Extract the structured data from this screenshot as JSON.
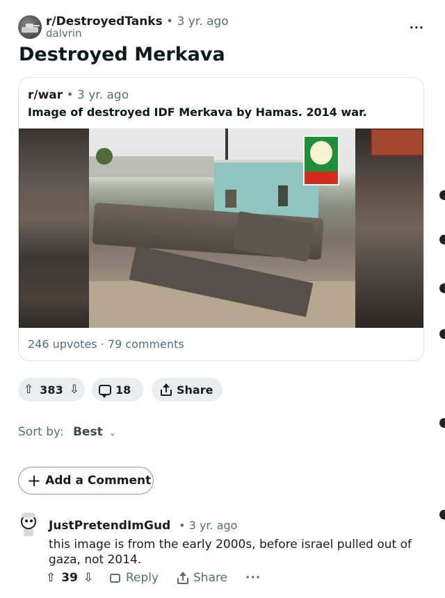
{
  "post": {
    "subreddit": "r/DestroyedTanks",
    "separator": "•",
    "time": "3 yr. ago",
    "author": "dalvrin",
    "overflow": "···",
    "title": "Destroyed Merkava"
  },
  "crosspost": {
    "subreddit": "r/war",
    "separator": "•",
    "time": "3 yr. ago",
    "title": "Image of destroyed IDF Merkava by Hamas. 2014 war.",
    "stats": "246 upvotes · 79 comments",
    "image_icon": "destroyed-tank-photo"
  },
  "actions": {
    "score": "383",
    "comments": "18",
    "share": "Share"
  },
  "sort": {
    "label": "Sort by:",
    "value": "Best"
  },
  "add_comment": {
    "label": "Add a Comment"
  },
  "comments": [
    {
      "author": "JustPretendImGud",
      "time": "• 3 yr. ago",
      "text": "this image is from the early 2000s, before israel pulled out of gaza, not 2014.",
      "score": "39",
      "reply": "Reply",
      "share": "Share",
      "more": "···"
    }
  ],
  "colors": {
    "muted": "#576f76",
    "pill_bg": "#eaedef",
    "border": "#dfe3e5"
  }
}
